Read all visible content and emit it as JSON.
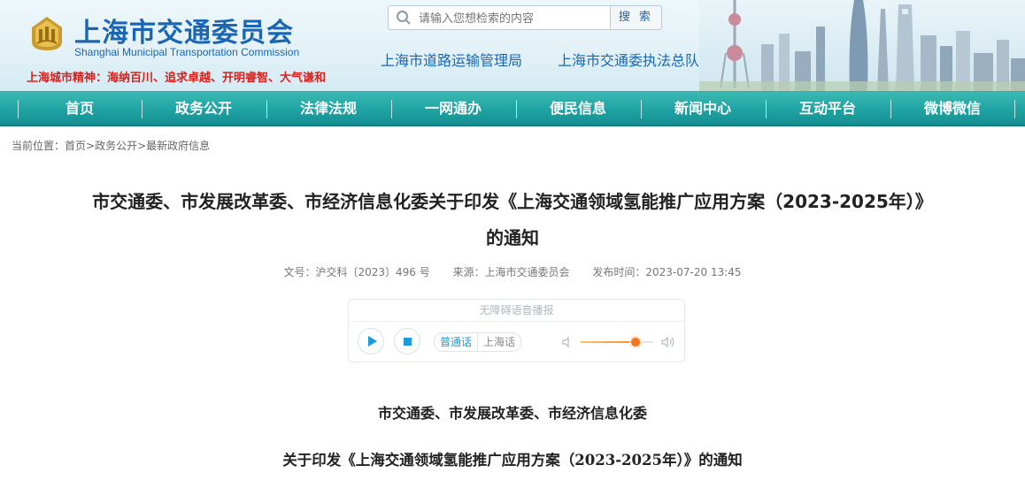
{
  "header": {
    "logo_cn": "上海市交通委员会",
    "logo_en": "Shanghai Municipal Transportation Commission",
    "city_spirit": "上海城市精神：海纳百川、追求卓越、开明睿智、大气谦和",
    "search": {
      "placeholder": "请输入您想检索的内容",
      "button_label": "搜 索"
    },
    "sub_links": [
      "上海市道路运输管理局",
      "上海市交通委执法总队"
    ]
  },
  "nav": {
    "items": [
      "首页",
      "政务公开",
      "法律法规",
      "一网通办",
      "便民信息",
      "新闻中心",
      "互动平台",
      "微博微信"
    ]
  },
  "breadcrumb": {
    "prefix": "当前位置：",
    "items": [
      "首页",
      "政务公开",
      "最新政府信息"
    ],
    "separator": ">"
  },
  "article": {
    "title_line1": "市交通委、市发展改革委、市经济信息化委关于印发《上海交通领域氢能推广应用方案（2023-2025年）》",
    "title_line2": "的通知",
    "meta": {
      "doc_no": "文号：沪交科〔2023〕496 号",
      "source": "来源：上海市交通委员会",
      "published": "发布时间：2023-07-20 13:45"
    },
    "body_line1": "市交通委、市发展改革委、市经济信息化委",
    "body_line2": "关于印发《上海交通领域氢能推广应用方案（2023-2025年）》的通知"
  },
  "player": {
    "header": "无障碍语音播报",
    "languages": [
      "普通话",
      "上海话"
    ],
    "active_language": "普通话",
    "volume": 0.75,
    "accent": "#1b9bd9",
    "volume_color": "#f5711f"
  },
  "colors": {
    "nav_bg": "#1fa3a2",
    "brand_blue": "#1a66b3",
    "spirit_red": "#d8201c"
  }
}
